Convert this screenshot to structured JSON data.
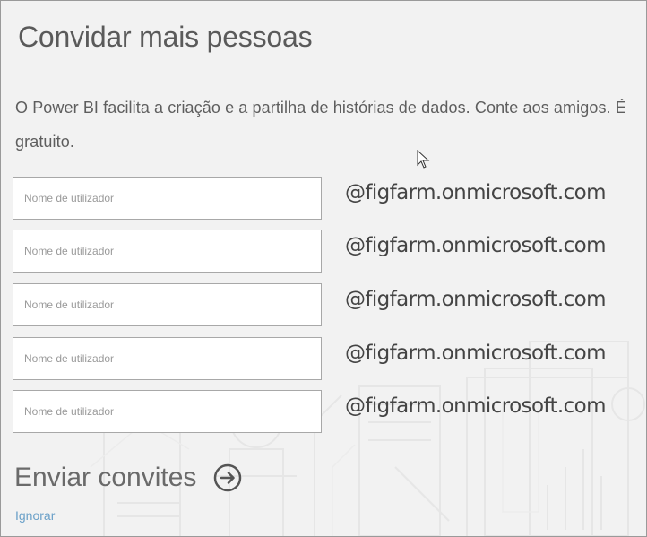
{
  "dialog": {
    "title": "Convidar mais pessoas",
    "description": "O Power BI facilita a criação e a partilha de histórias de dados. Conte aos amigos. É gratuito.",
    "rows": [
      {
        "placeholder": "Nome de utilizador",
        "domain": "@figfarm.onmicrosoft.com"
      },
      {
        "placeholder": "Nome de utilizador",
        "domain": "@figfarm.onmicrosoft.com"
      },
      {
        "placeholder": "Nome de utilizador",
        "domain": "@figfarm.onmicrosoft.com"
      },
      {
        "placeholder": "Nome de utilizador",
        "domain": "@figfarm.onmicrosoft.com"
      },
      {
        "placeholder": "Nome de utilizador",
        "domain": "@figfarm.onmicrosoft.com"
      }
    ],
    "send_label": "Enviar convites",
    "send_icon": "arrow-right-circle-icon",
    "ignore_label": "Ignorar"
  },
  "colors": {
    "background": "#f2f2f2",
    "link": "#6aa0c8",
    "title": "#5a5a5a"
  }
}
